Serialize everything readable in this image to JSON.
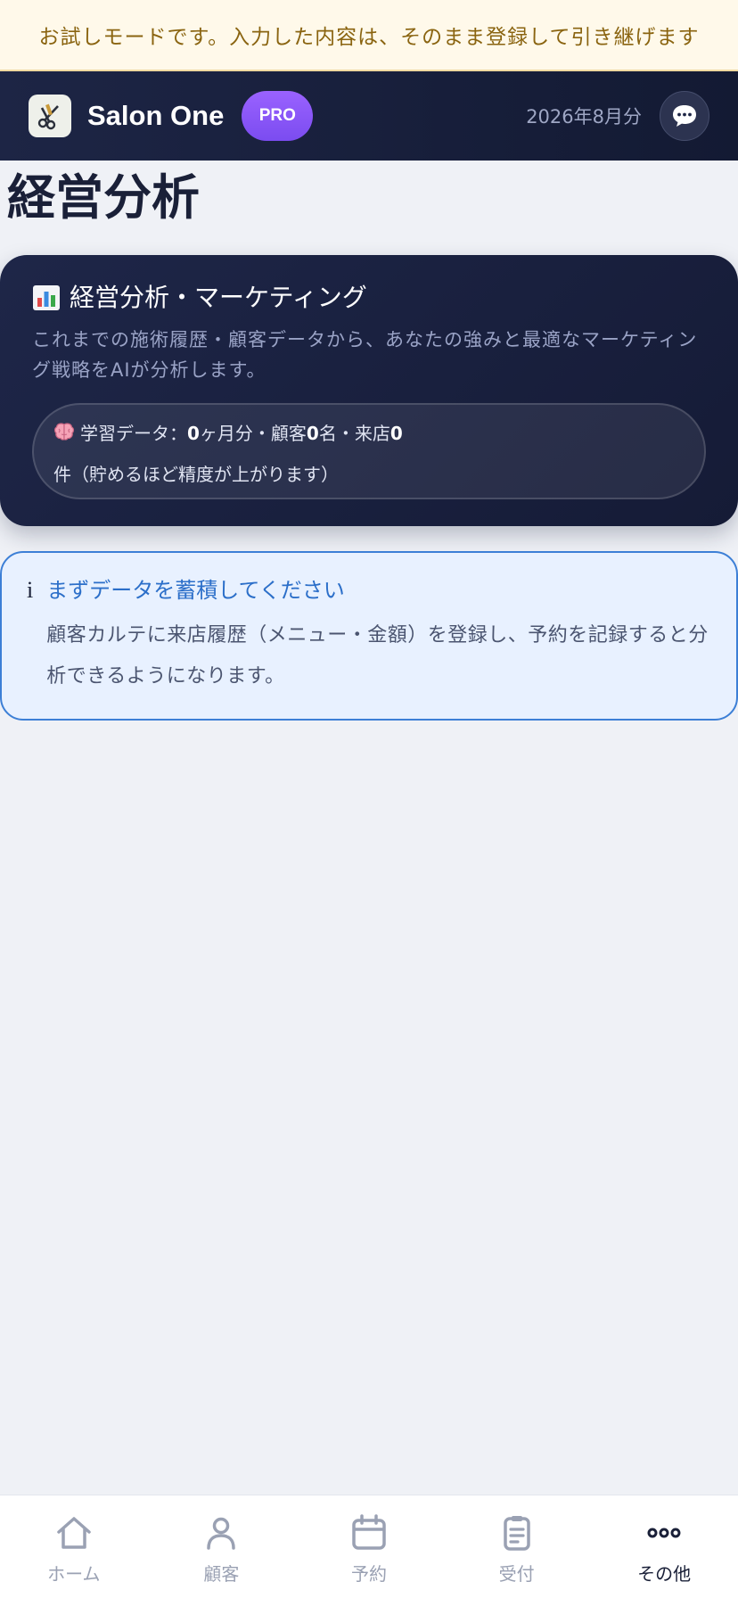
{
  "trial_banner": "お試しモードです。入力した内容は、そのまま登録して引き継げます",
  "header": {
    "app_name": "Salon One",
    "badge": "PRO",
    "period": "2026年8月分",
    "chat_icon": "chat-bubble-icon",
    "logo_icon": "scissors-comb-icon"
  },
  "page": {
    "title": "経営分析"
  },
  "hero": {
    "icon": "bar-chart-icon",
    "title": "経営分析・マーケティング",
    "description": "これまでの施術履歴・顧客データから、あなたの強みと最適なマーケティング戦略をAIが分析します。",
    "learning": {
      "icon": "brain-icon",
      "prefix": "学習データ：",
      "months": "0",
      "months_unit": "ヶ月分・顧客",
      "customers": "0",
      "customers_unit": "名・来店",
      "visits": "0",
      "visits_unit": "件（貯めるほど精度が上がります）"
    }
  },
  "notice": {
    "icon": "info-icon",
    "icon_glyph": "i",
    "title": "まずデータを蓄積してください",
    "text": "顧客カルテに来店履歴（メニュー・金額）を登録し、予約を記録すると分析できるようになります。"
  },
  "nav": {
    "items": [
      {
        "label": "ホーム",
        "icon": "home-icon",
        "active": false
      },
      {
        "label": "顧客",
        "icon": "person-icon",
        "active": false
      },
      {
        "label": "予約",
        "icon": "calendar-icon",
        "active": false
      },
      {
        "label": "受付",
        "icon": "clipboard-icon",
        "active": false
      },
      {
        "label": "その他",
        "icon": "more-icon",
        "active": true
      }
    ]
  },
  "colors": {
    "header_bg": "#1d2545",
    "accent_purple": "#8b5cf6",
    "info_blue": "#2c6fc9",
    "banner_text": "#8a6410"
  }
}
